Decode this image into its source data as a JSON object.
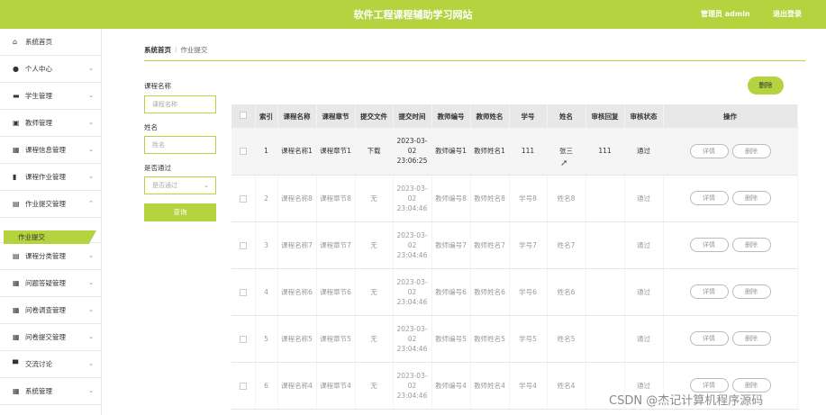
{
  "header": {
    "title": "软件工程课程辅助学习网站",
    "user": "管理员 admin",
    "logout": "退出登录"
  },
  "sidebar": {
    "items": [
      {
        "label": "系统首页",
        "icon": "home-icon",
        "glyph": "⌂",
        "chev": ""
      },
      {
        "label": "个人中心",
        "icon": "user-icon",
        "glyph": "●",
        "chev": "⌄"
      },
      {
        "label": "学生管理",
        "icon": "student-icon",
        "glyph": "▬",
        "chev": "⌄"
      },
      {
        "label": "教师管理",
        "icon": "clipboard-icon",
        "glyph": "▣",
        "chev": "⌄"
      },
      {
        "label": "课程信息管理",
        "icon": "grid-icon",
        "glyph": "▦",
        "chev": "⌄"
      },
      {
        "label": "课程作业管理",
        "icon": "bar-chart-icon",
        "glyph": "▮",
        "chev": "⌄"
      },
      {
        "label": "作业提交管理",
        "icon": "briefcase-icon",
        "glyph": "▤",
        "chev": "⌃"
      }
    ],
    "active_sub": "作业提交",
    "items_after": [
      {
        "label": "课程分类管理",
        "icon": "doc-icon",
        "glyph": "▤",
        "chev": "⌄"
      },
      {
        "label": "问题答疑管理",
        "icon": "grid-icon",
        "glyph": "▦",
        "chev": "⌄"
      },
      {
        "label": "问卷调查管理",
        "icon": "grid-icon",
        "glyph": "▦",
        "chev": "⌄"
      },
      {
        "label": "问卷提交管理",
        "icon": "grid-icon",
        "glyph": "▦",
        "chev": "⌄"
      },
      {
        "label": "交流讨论",
        "icon": "monitor-icon",
        "glyph": "▀",
        "chev": "⌄"
      },
      {
        "label": "系统管理",
        "icon": "grid-icon",
        "glyph": "▦",
        "chev": "⌄"
      }
    ]
  },
  "breadcrumb": {
    "home": "系统首页",
    "current": "作业提交"
  },
  "search": {
    "course_label": "课程名称",
    "course_placeholder": "课程名称",
    "name_label": "姓名",
    "name_placeholder": "姓名",
    "pass_label": "是否通过",
    "pass_placeholder": "是否通过",
    "button": "查询"
  },
  "delete_button": "删除",
  "table": {
    "headers": [
      "索引",
      "课程名称",
      "课程章节",
      "提交文件",
      "提交时间",
      "教师编号",
      "教师姓名",
      "学号",
      "姓名",
      "审核回复",
      "审核状态",
      "操作"
    ],
    "rows": [
      {
        "idx": "1",
        "course": "课程名称1",
        "chapter": "课程章节1",
        "file": "下载",
        "time": "2023-03-02 23:06:25",
        "tno": "教师编号1",
        "tname": "教师姓名1",
        "sno": "111",
        "sname": "张三",
        "reply": "111",
        "status": "通过"
      },
      {
        "idx": "2",
        "course": "课程名称8",
        "chapter": "课程章节8",
        "file": "无",
        "time": "2023-03-02 23:04:46",
        "tno": "教师编号8",
        "tname": "教师姓名8",
        "sno": "学号8",
        "sname": "姓名8",
        "reply": "",
        "status": "通过"
      },
      {
        "idx": "3",
        "course": "课程名称7",
        "chapter": "课程章节7",
        "file": "无",
        "time": "2023-03-02 23:04:46",
        "tno": "教师编号7",
        "tname": "教师姓名7",
        "sno": "学号7",
        "sname": "姓名7",
        "reply": "",
        "status": "通过"
      },
      {
        "idx": "4",
        "course": "课程名称6",
        "chapter": "课程章节6",
        "file": "无",
        "time": "2023-03-02 23:04:46",
        "tno": "教师编号6",
        "tname": "教师姓名6",
        "sno": "学号6",
        "sname": "姓名6",
        "reply": "",
        "status": "通过"
      },
      {
        "idx": "5",
        "course": "课程名称5",
        "chapter": "课程章节5",
        "file": "无",
        "time": "2023-03-02 23:04:46",
        "tno": "教师编号5",
        "tname": "教师姓名5",
        "sno": "学号5",
        "sname": "姓名5",
        "reply": "",
        "status": "通过"
      },
      {
        "idx": "6",
        "course": "课程名称4",
        "chapter": "课程章节4",
        "file": "无",
        "time": "2023-03-02 23:04:46",
        "tno": "教师编号4",
        "tname": "教师姓名4",
        "sno": "学号4",
        "sname": "姓名4",
        "reply": "",
        "status": "通过"
      }
    ],
    "detail_label": "详情",
    "delete_label": "删除"
  },
  "watermark": "CSDN @杰记计算机程序源码",
  "colors": {
    "accent": "#b5d23f"
  }
}
